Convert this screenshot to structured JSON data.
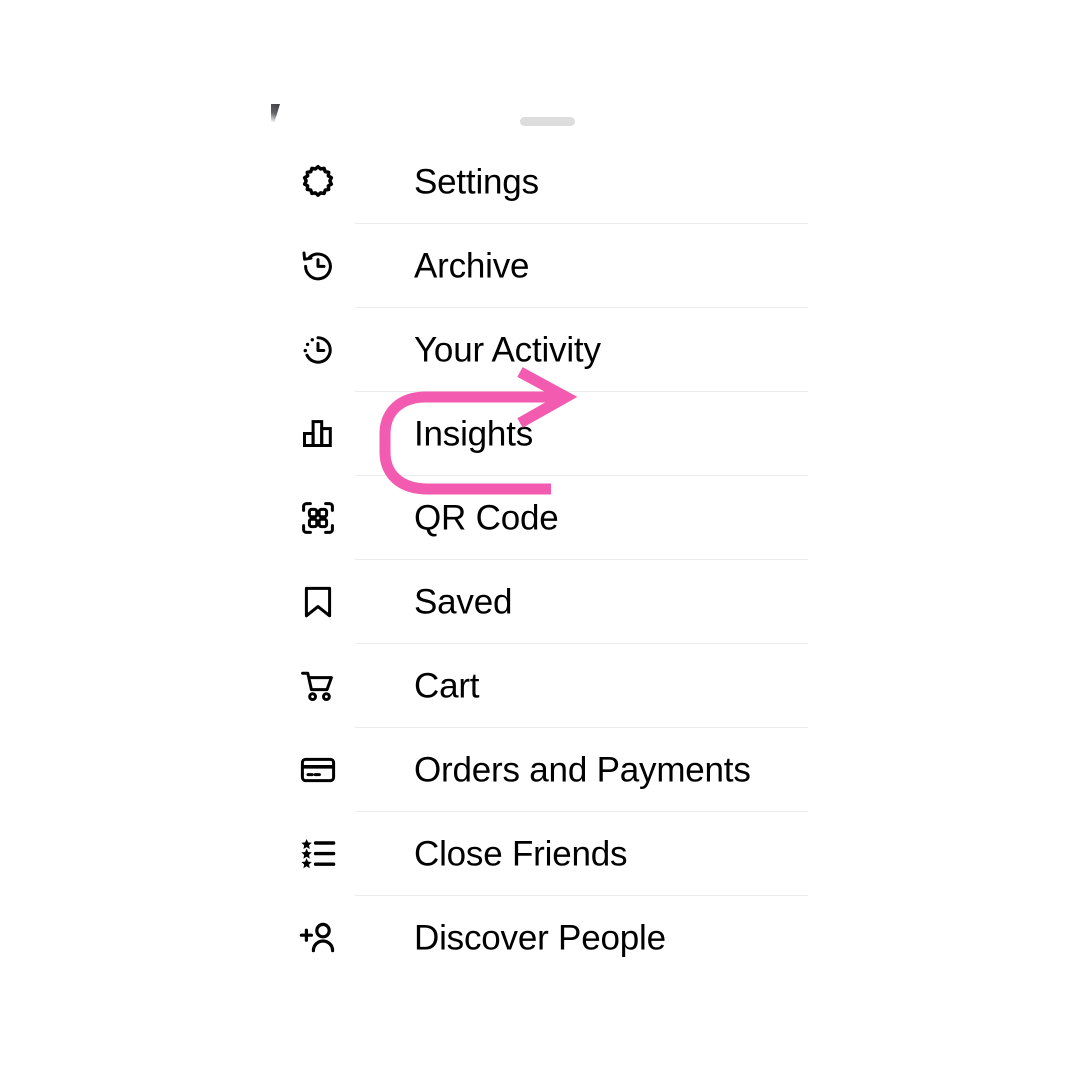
{
  "screen": {
    "background_color": "#ffffff",
    "app_context": "Instagram profile side menu sheet"
  },
  "sheet": {
    "drag_handle": "drag-handle",
    "handle_color": "#dddddd",
    "divider_color": "#ececec"
  },
  "menu": {
    "items": [
      {
        "label": "Settings",
        "icon": "gear-icon"
      },
      {
        "label": "Archive",
        "icon": "archive-clock-icon"
      },
      {
        "label": "Your Activity",
        "icon": "activity-clock-icon"
      },
      {
        "label": "Insights",
        "icon": "bar-chart-icon"
      },
      {
        "label": "QR Code",
        "icon": "qr-code-icon"
      },
      {
        "label": "Saved",
        "icon": "bookmark-icon"
      },
      {
        "label": "Cart",
        "icon": "shopping-cart-icon"
      },
      {
        "label": "Orders and Payments",
        "icon": "credit-card-icon"
      },
      {
        "label": "Close Friends",
        "icon": "star-list-icon"
      },
      {
        "label": "Discover People",
        "icon": "person-plus-icon"
      }
    ]
  },
  "annotation": {
    "type": "u-turn-arrow",
    "color": "#F25BAF",
    "stroke_width": 11,
    "points_to": "Insights",
    "description": "Hand-drawn pink U-turn arrow circling the Insights row, arrowhead pointing right"
  }
}
